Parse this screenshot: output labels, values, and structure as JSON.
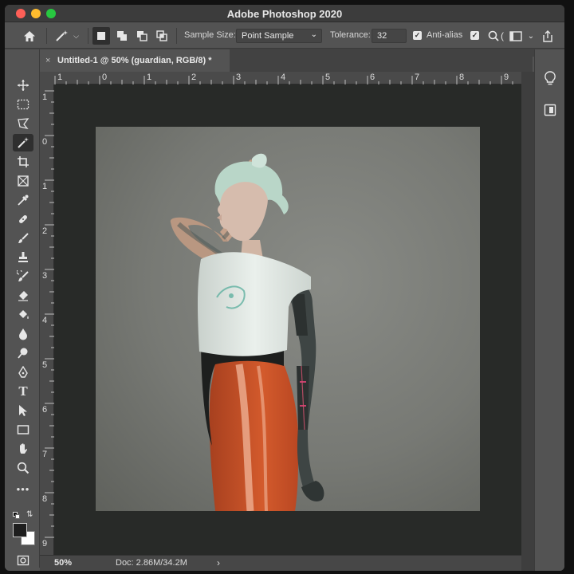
{
  "app": {
    "title": "Adobe Photoshop 2020"
  },
  "options_bar": {
    "sample_size_label": "Sample Size:",
    "sample_size_value": "Point Sample",
    "tolerance_label": "Tolerance:",
    "tolerance_value": "32",
    "anti_alias_label": "Anti-alias",
    "anti_alias_checked": true,
    "contiguous_checked": true
  },
  "document": {
    "tab_title": "Untitled-1 @ 50% (guardian, RGB/8) *",
    "zoom": "50%",
    "doc_size": "Doc: 2.86M/34.2M"
  },
  "ruler": {
    "horizontal": [
      "1",
      "0",
      "1",
      "2",
      "3",
      "4",
      "5",
      "6",
      "7",
      "8",
      "9"
    ],
    "vertical": [
      "1",
      "0",
      "1",
      "2",
      "3",
      "4",
      "5",
      "6",
      "7",
      "8",
      "9"
    ]
  },
  "toolbar": {
    "active_tool": "magic-wand",
    "foreground_color": "#1e1e1e",
    "background_color": "#ffffff"
  },
  "colors": {
    "canvas_background": "#7d7f7a",
    "pasteboard": "#282a28",
    "shirt": "#dfe6e1",
    "pants": "#c8522a",
    "hair": "#b9d6c8"
  }
}
